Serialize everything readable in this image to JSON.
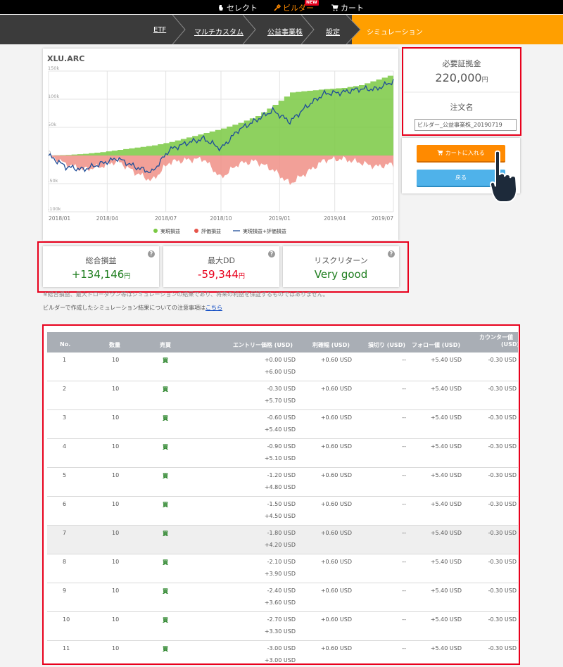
{
  "topnav": {
    "items": [
      {
        "label": "セレクト",
        "icon": "select-icon"
      },
      {
        "label": "ビルダー",
        "icon": "builder-icon",
        "badge": "NEW"
      },
      {
        "label": "カート",
        "icon": "cart-icon"
      }
    ]
  },
  "breadcrumb": [
    "ETF",
    "マルチカスタム",
    "公益事業株",
    "設定",
    "シミュレーション"
  ],
  "chart": {
    "symbol": "XLU.ARC",
    "legend": [
      "実現損益",
      "評価損益",
      "実現損益+評価損益"
    ],
    "colors": {
      "realized": "#7ac943",
      "unrealized": "#f08f86",
      "total": "#1f4e99"
    }
  },
  "chart_data": {
    "type": "area",
    "x_ticks": [
      "2018/01",
      "2018/04",
      "2018/07",
      "2018/10",
      "2019/01",
      "2019/04",
      "2019/07"
    ],
    "y_ticks": [
      "150k",
      "100k",
      "50k",
      "0",
      "-50k",
      "-100k"
    ],
    "ylim": [
      -100000,
      150000
    ],
    "grid": true,
    "legend_position": "bottom",
    "series": [
      {
        "name": "実現損益",
        "color": "#7ac943",
        "x": [
          0.0,
          0.05,
          0.1,
          0.15,
          0.2,
          0.25,
          0.3,
          0.35,
          0.4,
          0.45,
          0.5,
          0.55,
          0.6,
          0.65,
          0.7,
          0.75,
          0.8,
          0.85,
          0.9,
          0.95,
          1.0
        ],
        "values": [
          0,
          1000,
          3000,
          6000,
          10000,
          14000,
          18000,
          24000,
          32000,
          40000,
          48000,
          58000,
          70000,
          90000,
          112000,
          115000,
          118000,
          120000,
          125000,
          135000,
          145000
        ]
      },
      {
        "name": "評価損益",
        "color": "#f08f86",
        "x": [
          0.0,
          0.05,
          0.1,
          0.15,
          0.2,
          0.25,
          0.3,
          0.35,
          0.4,
          0.45,
          0.5,
          0.55,
          0.6,
          0.65,
          0.7,
          0.75,
          0.8,
          0.85,
          0.9,
          0.95,
          1.0
        ],
        "values": [
          0,
          -15000,
          -25000,
          -20000,
          -10000,
          -30000,
          -45000,
          -12000,
          -8000,
          -6000,
          -40000,
          -15000,
          -10000,
          -25000,
          -50000,
          -30000,
          -8000,
          -6000,
          -12000,
          -20000,
          -15000
        ]
      },
      {
        "name": "実現損益+評価損益",
        "color": "#1f4e99",
        "x": [
          0.0,
          0.05,
          0.1,
          0.15,
          0.2,
          0.25,
          0.3,
          0.35,
          0.4,
          0.45,
          0.5,
          0.55,
          0.6,
          0.65,
          0.7,
          0.75,
          0.8,
          0.85,
          0.9,
          0.95,
          1.0
        ],
        "values": [
          0,
          -20000,
          -25000,
          -15000,
          -5000,
          -20000,
          -30000,
          10000,
          22000,
          30000,
          12000,
          45000,
          62000,
          80000,
          60000,
          88000,
          110000,
          112000,
          118000,
          118000,
          132000
        ]
      }
    ]
  },
  "stats": {
    "total": {
      "label": "総合損益",
      "value": "+134,146",
      "unit": "円"
    },
    "max_dd": {
      "label": "最大DD",
      "value": "-59,344",
      "unit": "円"
    },
    "risk_return": {
      "label": "リスクリターン",
      "value": "Very good"
    }
  },
  "disclaimer": "※総合損益、最大ドローダウン等はシミュレーションの結果であり、将来の利益を保証するものではありません。",
  "note": {
    "text": "ビルダーで作成したシミュレーション結果についての注意事項は",
    "link": "こちら"
  },
  "margin": {
    "label": "必要証拠金",
    "value": "220,000",
    "unit": "円"
  },
  "order_name": {
    "label": "注文名",
    "value": "ビルダー_公益事業株_20190719"
  },
  "buttons": {
    "cart": "カートに入れる",
    "back": "戻る"
  },
  "table": {
    "headers": {
      "no": "No.",
      "qty": "数量",
      "side": "売買",
      "entry": "エントリー価格 (USD)",
      "take_profit": "利確幅 (USD)",
      "stop_loss": "損切り (USD)",
      "follow": "フォロー値 (USD)",
      "counter_1": "カウンター値",
      "counter_2": "(USD)"
    },
    "rows": [
      {
        "no": "1",
        "qty": "10",
        "side": "買",
        "entry1": "+0.00 USD",
        "entry2": "+6.00 USD",
        "tp": "+0.60 USD",
        "sl": "--",
        "follow": "+5.40 USD",
        "counter": "-0.30 USD"
      },
      {
        "no": "2",
        "qty": "10",
        "side": "買",
        "entry1": "-0.30 USD",
        "entry2": "+5.70 USD",
        "tp": "+0.60 USD",
        "sl": "--",
        "follow": "+5.40 USD",
        "counter": "-0.30 USD"
      },
      {
        "no": "3",
        "qty": "10",
        "side": "買",
        "entry1": "-0.60 USD",
        "entry2": "+5.40 USD",
        "tp": "+0.60 USD",
        "sl": "--",
        "follow": "+5.40 USD",
        "counter": "-0.30 USD"
      },
      {
        "no": "4",
        "qty": "10",
        "side": "買",
        "entry1": "-0.90 USD",
        "entry2": "+5.10 USD",
        "tp": "+0.60 USD",
        "sl": "--",
        "follow": "+5.40 USD",
        "counter": "-0.30 USD"
      },
      {
        "no": "5",
        "qty": "10",
        "side": "買",
        "entry1": "-1.20 USD",
        "entry2": "+4.80 USD",
        "tp": "+0.60 USD",
        "sl": "--",
        "follow": "+5.40 USD",
        "counter": "-0.30 USD"
      },
      {
        "no": "6",
        "qty": "10",
        "side": "買",
        "entry1": "-1.50 USD",
        "entry2": "+4.50 USD",
        "tp": "+0.60 USD",
        "sl": "--",
        "follow": "+5.40 USD",
        "counter": "-0.30 USD"
      },
      {
        "no": "7",
        "qty": "10",
        "side": "買",
        "entry1": "-1.80 USD",
        "entry2": "+4.20 USD",
        "tp": "+0.60 USD",
        "sl": "--",
        "follow": "+5.40 USD",
        "counter": "-0.30 USD"
      },
      {
        "no": "8",
        "qty": "10",
        "side": "買",
        "entry1": "-2.10 USD",
        "entry2": "+3.90 USD",
        "tp": "+0.60 USD",
        "sl": "--",
        "follow": "+5.40 USD",
        "counter": "-0.30 USD"
      },
      {
        "no": "9",
        "qty": "10",
        "side": "買",
        "entry1": "-2.40 USD",
        "entry2": "+3.60 USD",
        "tp": "+0.60 USD",
        "sl": "--",
        "follow": "+5.40 USD",
        "counter": "-0.30 USD"
      },
      {
        "no": "10",
        "qty": "10",
        "side": "買",
        "entry1": "-2.70 USD",
        "entry2": "+3.30 USD",
        "tp": "+0.60 USD",
        "sl": "--",
        "follow": "+5.40 USD",
        "counter": "-0.30 USD"
      },
      {
        "no": "11",
        "qty": "10",
        "side": "買",
        "entry1": "-3.00 USD",
        "entry2": "+3.00 USD",
        "tp": "+0.60 USD",
        "sl": "--",
        "follow": "+5.40 USD",
        "counter": "-0.30 USD"
      }
    ]
  }
}
